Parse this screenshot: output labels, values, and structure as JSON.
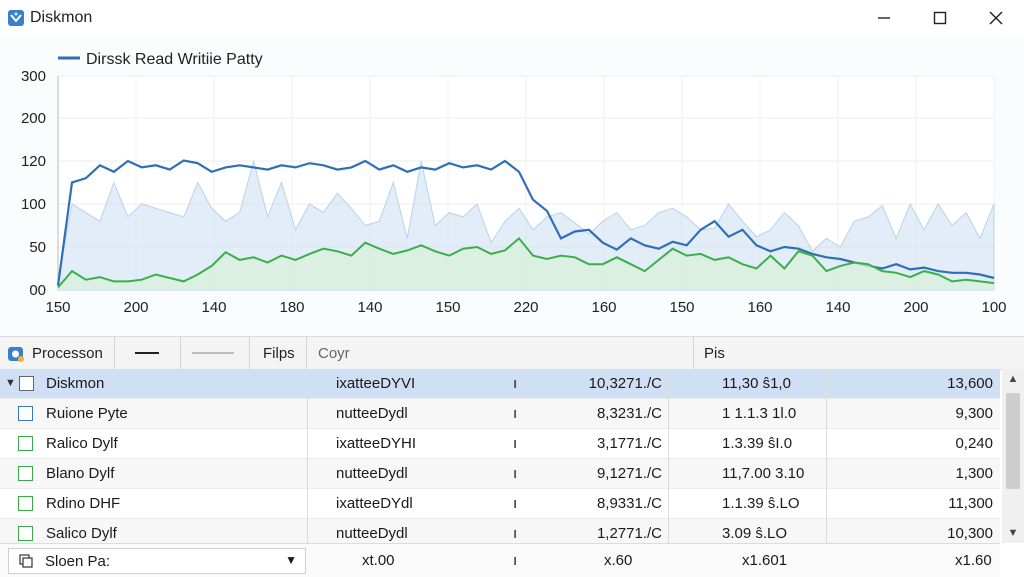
{
  "window": {
    "title": "Diskmon"
  },
  "chart_data": {
    "type": "line",
    "legend": "Dirssk Read Writiie Patty",
    "y_ticks": [
      "300",
      "200",
      "120",
      "100",
      "50",
      "00"
    ],
    "y_tick_values": [
      300,
      200,
      120,
      100,
      50,
      0
    ],
    "x_ticks": [
      "150",
      "200",
      "140",
      "180",
      "140",
      "150",
      "220",
      "160",
      "150",
      "160",
      "140",
      "200",
      "100"
    ],
    "series": [
      {
        "color": "#2f6fb6",
        "values": [
          5,
          110,
          112,
          118,
          115,
          120,
          117,
          118,
          116,
          121,
          119,
          115,
          117,
          118,
          117,
          116,
          118,
          117,
          119,
          118,
          116,
          117,
          120,
          116,
          118,
          115,
          117,
          116,
          119,
          117,
          118,
          116,
          120,
          115,
          102,
          92,
          60,
          68,
          70,
          55,
          47,
          60,
          52,
          48,
          56,
          52,
          70,
          80,
          62,
          70,
          52,
          45,
          50,
          48,
          42,
          38,
          36,
          32,
          28,
          25,
          30,
          24,
          26,
          22,
          20,
          20,
          18,
          14
        ]
      },
      {
        "color": "#3bb04a",
        "values": [
          3,
          22,
          12,
          15,
          10,
          10,
          12,
          18,
          14,
          10,
          18,
          28,
          44,
          35,
          38,
          32,
          40,
          35,
          42,
          48,
          45,
          40,
          55,
          48,
          42,
          46,
          52,
          45,
          40,
          48,
          50,
          42,
          46,
          60,
          40,
          36,
          40,
          38,
          30,
          30,
          38,
          30,
          22,
          35,
          48,
          40,
          42,
          35,
          38,
          30,
          25,
          40,
          25,
          45,
          40,
          22,
          28,
          32,
          30,
          22,
          20,
          15,
          22,
          18,
          10,
          12,
          10,
          8
        ]
      },
      {
        "color": "#b9d3ea",
        "values": [
          10,
          100,
          90,
          80,
          110,
          85,
          100,
          95,
          90,
          85,
          110,
          95,
          80,
          90,
          120,
          85,
          110,
          70,
          100,
          90,
          105,
          95,
          75,
          80,
          110,
          60,
          120,
          75,
          90,
          85,
          100,
          55,
          80,
          95,
          70,
          85,
          90,
          78,
          65,
          80,
          90,
          70,
          75,
          90,
          95,
          85,
          70,
          72,
          100,
          80,
          62,
          70,
          90,
          75,
          45,
          60,
          50,
          80,
          85,
          98,
          60,
          100,
          70,
          100,
          75,
          90,
          60,
          100
        ]
      }
    ]
  },
  "table": {
    "header": {
      "processes_label": "Processon",
      "col_filps": "Filps",
      "col_coyr": "Coyr",
      "col_pis": "Pis"
    },
    "rows": [
      {
        "name": "Diskmon",
        "type": "ixatteeDYVI",
        "arrow": "ı",
        "val1": "10,3271./C",
        "val2": "11,30 ŝ1,0",
        "val3": "13,600",
        "selected": true
      },
      {
        "name": "Ruione Pyte",
        "type": "nutteeDydl",
        "arrow": "ı",
        "val1": "8,3231./C",
        "val2": "1 1.1.3 1l.0",
        "val3": "9,300"
      },
      {
        "name": "Ralico Dylf",
        "type": "ixatteeDYHI",
        "arrow": "ı",
        "val1": "3,1771./C",
        "val2": "1.3.39 ŝI.0",
        "val3": "0,240"
      },
      {
        "name": "Blano Dylf",
        "type": "nutteeDydl",
        "arrow": "ı",
        "val1": "9,1271./C",
        "val2": "11,7.00 3.10",
        "val3": "1,300"
      },
      {
        "name": "Rdino DHF",
        "type": "ixatteeDYdl",
        "arrow": "ı",
        "val1": "8,9331./C",
        "val2": "1.1.39 ŝ.LO",
        "val3": "11,300"
      },
      {
        "name": "Salico Dylf",
        "type": "nutteeDydl",
        "arrow": "ı",
        "val1": "1,2771./C",
        "val2": "3.09 ŝ.LO",
        "val3": "10,300"
      }
    ],
    "footer": {
      "combo_text": "Sloen Pa:",
      "val_a": "xt.00",
      "arrow": "ı",
      "val_b": "x.60",
      "val_c": "x1.601",
      "val_d": "x1.60"
    }
  }
}
